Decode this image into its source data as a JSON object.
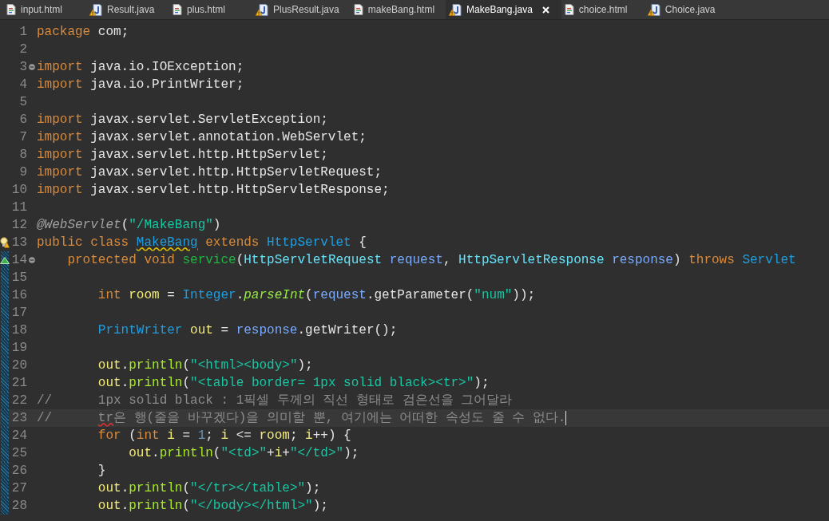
{
  "tabs": [
    {
      "label": "input.html",
      "kind": "html",
      "selected": false
    },
    {
      "label": "Result.java",
      "kind": "java",
      "selected": false
    },
    {
      "label": "plus.html",
      "kind": "html",
      "selected": false
    },
    {
      "label": "PlusResult.java",
      "kind": "java",
      "selected": false
    },
    {
      "label": "makeBang.html",
      "kind": "html",
      "selected": false
    },
    {
      "label": "MakeBang.java",
      "kind": "java",
      "selected": true
    },
    {
      "label": "choice.html",
      "kind": "html",
      "selected": false
    },
    {
      "label": "Choice.java",
      "kind": "java",
      "selected": false
    }
  ],
  "lines": [
    {
      "number": "1",
      "tokens": [
        {
          "kind": "kw",
          "text": "package"
        },
        {
          "kind": "plain",
          "text": " com;"
        }
      ]
    },
    {
      "number": "2"
    },
    {
      "number": "3",
      "fold": true,
      "tokens": [
        {
          "kind": "kw",
          "text": "import"
        },
        {
          "kind": "plain",
          "text": " java.io.IOException;"
        }
      ]
    },
    {
      "number": "4",
      "tokens": [
        {
          "kind": "kw",
          "text": "import"
        },
        {
          "kind": "plain",
          "text": " java.io.PrintWriter;"
        }
      ]
    },
    {
      "number": "5"
    },
    {
      "number": "6",
      "tokens": [
        {
          "kind": "kw",
          "text": "import"
        },
        {
          "kind": "plain",
          "text": " javax.servlet.ServletException;"
        }
      ]
    },
    {
      "number": "7",
      "tokens": [
        {
          "kind": "kw",
          "text": "import"
        },
        {
          "kind": "plain",
          "text": " javax.servlet.annotation.WebServlet;"
        }
      ]
    },
    {
      "number": "8",
      "tokens": [
        {
          "kind": "kw",
          "text": "import"
        },
        {
          "kind": "plain",
          "text": " javax.servlet.http.HttpServlet;"
        }
      ]
    },
    {
      "number": "9",
      "tokens": [
        {
          "kind": "kw",
          "text": "import"
        },
        {
          "kind": "plain",
          "text": " javax.servlet.http.HttpServletRequest;"
        }
      ]
    },
    {
      "number": "10",
      "tokens": [
        {
          "kind": "kw",
          "text": "import"
        },
        {
          "kind": "plain",
          "text": " javax.servlet.http.HttpServletResponse;"
        }
      ]
    },
    {
      "number": "11"
    },
    {
      "number": "12",
      "tokens": [
        {
          "kind": "annotation",
          "text": "@WebServlet"
        },
        {
          "kind": "plain",
          "text": "("
        },
        {
          "kind": "string",
          "text": "\"/MakeBang\""
        },
        {
          "kind": "plain",
          "text": ")"
        }
      ]
    },
    {
      "number": "13",
      "warning": true,
      "tokens": [
        {
          "kind": "kw",
          "text": "public class "
        },
        {
          "kind": "class",
          "text": "MakeBang",
          "warning": true
        },
        {
          "kind": "kw",
          "text": " extends "
        },
        {
          "kind": "class",
          "text": "HttpServlet"
        },
        {
          "kind": "plain",
          "text": " {"
        }
      ]
    },
    {
      "number": "14",
      "override": true,
      "fold": true,
      "changed": true,
      "tokens": [
        {
          "kind": "kw",
          "text": "    protected void "
        },
        {
          "kind": "method",
          "text": "service"
        },
        {
          "kind": "plain",
          "text": "("
        },
        {
          "kind": "iface",
          "text": "HttpServletRequest"
        },
        {
          "kind": "param",
          "text": " request"
        },
        {
          "kind": "plain",
          "text": ", "
        },
        {
          "kind": "iface",
          "text": "HttpServletResponse"
        },
        {
          "kind": "param",
          "text": " response"
        },
        {
          "kind": "plain",
          "text": ") "
        },
        {
          "kind": "kw",
          "text": "throws "
        },
        {
          "kind": "class",
          "text": "Servlet"
        }
      ]
    },
    {
      "number": "15",
      "changed": true
    },
    {
      "number": "16",
      "changed": true,
      "tokens": [
        {
          "kind": "kw",
          "text": "        int "
        },
        {
          "kind": "local",
          "text": "room"
        },
        {
          "kind": "plain",
          "text": " = "
        },
        {
          "kind": "class",
          "text": "Integer"
        },
        {
          "kind": "plain",
          "text": "."
        },
        {
          "kind": "static",
          "text": "parseInt"
        },
        {
          "kind": "plain",
          "text": "("
        },
        {
          "kind": "param",
          "text": "request"
        },
        {
          "kind": "plain",
          "text": ".getParameter("
        },
        {
          "kind": "string",
          "text": "\"num\""
        },
        {
          "kind": "plain",
          "text": "));"
        }
      ]
    },
    {
      "number": "17",
      "changed": true
    },
    {
      "number": "18",
      "changed": true,
      "tokens": [
        {
          "kind": "class",
          "text": "        PrintWriter"
        },
        {
          "kind": "local",
          "text": " out"
        },
        {
          "kind": "plain",
          "text": " = "
        },
        {
          "kind": "param",
          "text": "response"
        },
        {
          "kind": "plain",
          "text": ".getWriter();"
        }
      ]
    },
    {
      "number": "19",
      "changed": true
    },
    {
      "number": "20",
      "changed": true,
      "tokens": [
        {
          "kind": "local",
          "text": "        out"
        },
        {
          "kind": "plain",
          "text": "."
        },
        {
          "kind": "call",
          "text": "println"
        },
        {
          "kind": "plain",
          "text": "("
        },
        {
          "kind": "string",
          "text": "\"<html><body>\""
        },
        {
          "kind": "plain",
          "text": ");"
        }
      ]
    },
    {
      "number": "21",
      "changed": true,
      "tokens": [
        {
          "kind": "local",
          "text": "        out"
        },
        {
          "kind": "plain",
          "text": "."
        },
        {
          "kind": "call",
          "text": "println"
        },
        {
          "kind": "plain",
          "text": "("
        },
        {
          "kind": "string",
          "text": "\"<table border= 1px solid black><tr>\""
        },
        {
          "kind": "plain",
          "text": ");"
        }
      ]
    },
    {
      "number": "22",
      "changed": true,
      "tokens": [
        {
          "kind": "comment",
          "text": "//      1px solid black : 1픽셀 두께의 직선 형태로 검은선을 그어달라"
        }
      ]
    },
    {
      "number": "23",
      "changed": true,
      "current": true,
      "tokens": [
        {
          "kind": "comment",
          "text": "//      tr",
          "misspelled": true
        },
        {
          "kind": "comment",
          "text": "은 행(줄을 바꾸겠다)을 의미할 뿐, 여기에는 어떠한 속성도 줄 수 없다."
        }
      ]
    },
    {
      "number": "24",
      "changed": true,
      "tokens": [
        {
          "kind": "kw",
          "text": "        for"
        },
        {
          "kind": "plain",
          "text": " ("
        },
        {
          "kind": "kw",
          "text": "int"
        },
        {
          "kind": "local",
          "text": " i"
        },
        {
          "kind": "plain",
          "text": " = "
        },
        {
          "kind": "number",
          "text": "1"
        },
        {
          "kind": "plain",
          "text": "; "
        },
        {
          "kind": "local",
          "text": "i"
        },
        {
          "kind": "plain",
          "text": " <= "
        },
        {
          "kind": "local",
          "text": "room"
        },
        {
          "kind": "plain",
          "text": "; "
        },
        {
          "kind": "local",
          "text": "i"
        },
        {
          "kind": "plain",
          "text": "++) {"
        }
      ]
    },
    {
      "number": "25",
      "changed": true,
      "tokens": [
        {
          "kind": "local",
          "text": "            out"
        },
        {
          "kind": "plain",
          "text": "."
        },
        {
          "kind": "call",
          "text": "println"
        },
        {
          "kind": "plain",
          "text": "("
        },
        {
          "kind": "string",
          "text": "\"<td>\""
        },
        {
          "kind": "plain",
          "text": "+"
        },
        {
          "kind": "local",
          "text": "i"
        },
        {
          "kind": "plain",
          "text": "+"
        },
        {
          "kind": "string",
          "text": "\"</td>\""
        },
        {
          "kind": "plain",
          "text": ");"
        }
      ]
    },
    {
      "number": "26",
      "changed": true,
      "tokens": [
        {
          "kind": "plain",
          "text": "        }"
        }
      ]
    },
    {
      "number": "27",
      "changed": true,
      "tokens": [
        {
          "kind": "local",
          "text": "        out"
        },
        {
          "kind": "plain",
          "text": "."
        },
        {
          "kind": "call",
          "text": "println"
        },
        {
          "kind": "plain",
          "text": "("
        },
        {
          "kind": "string",
          "text": "\"</tr></table>\""
        },
        {
          "kind": "plain",
          "text": ");"
        }
      ]
    },
    {
      "number": "28",
      "changed": true,
      "tokens": [
        {
          "kind": "local",
          "text": "        out"
        },
        {
          "kind": "plain",
          "text": "."
        },
        {
          "kind": "call",
          "text": "println"
        },
        {
          "kind": "plain",
          "text": "("
        },
        {
          "kind": "string",
          "text": "\"</body></html>\""
        },
        {
          "kind": "plain",
          "text": ");"
        }
      ]
    }
  ]
}
